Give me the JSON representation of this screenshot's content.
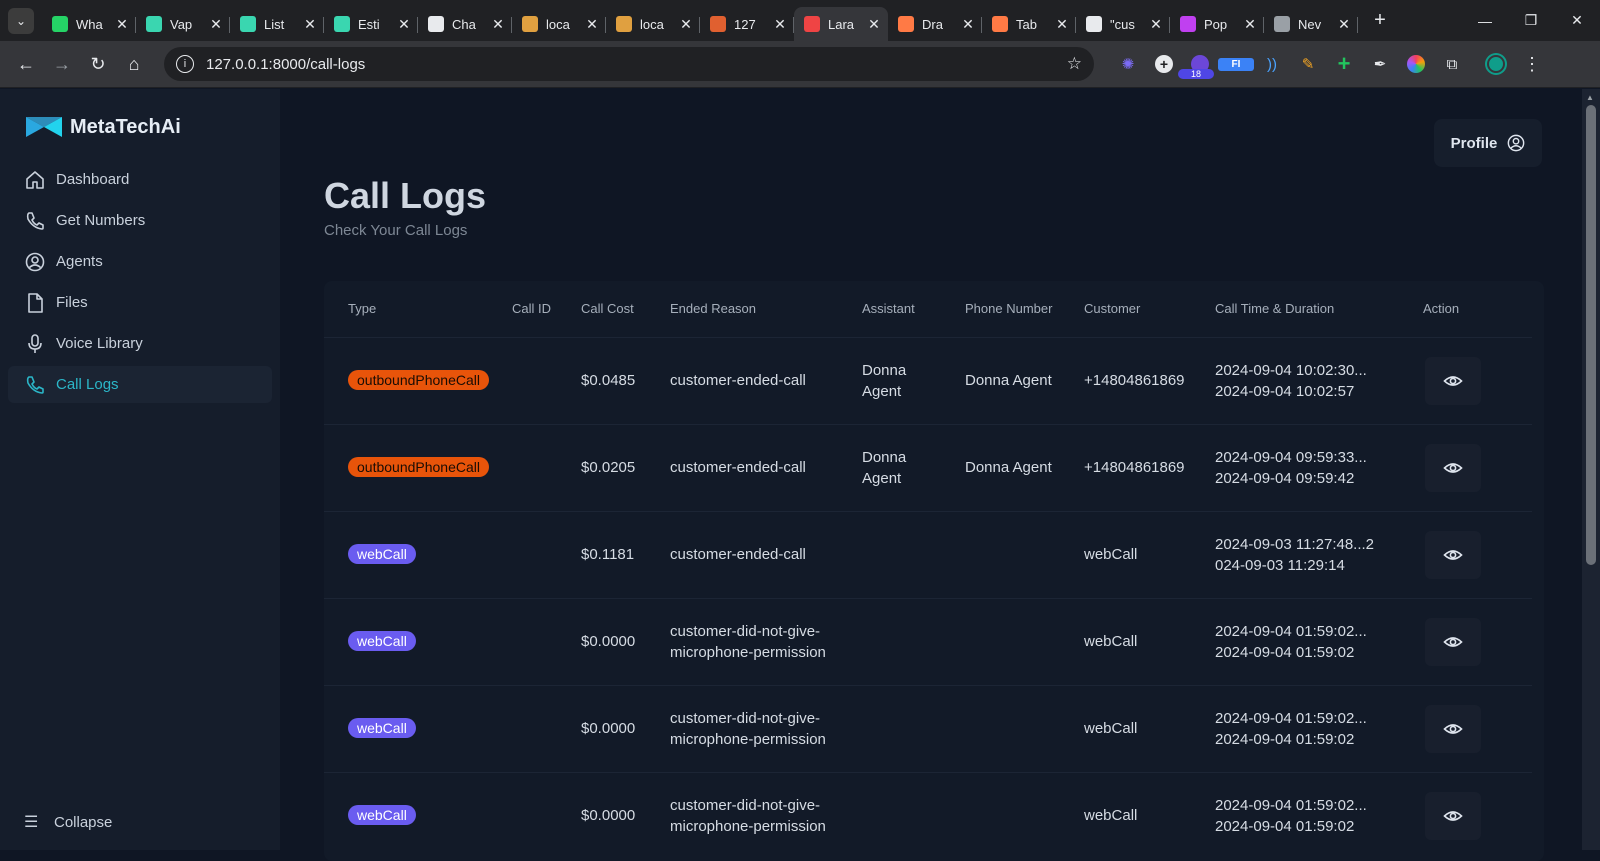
{
  "browser": {
    "tabs": [
      {
        "label": "Wha",
        "icon": "whatsapp-icon",
        "color": "#25d366"
      },
      {
        "label": "Vap",
        "icon": "v-icon",
        "color": "#3ad6b0"
      },
      {
        "label": "List",
        "icon": "v-icon",
        "color": "#3ad6b0"
      },
      {
        "label": "Esti",
        "icon": "v-icon",
        "color": "#3ad6b0"
      },
      {
        "label": "Cha",
        "icon": "chatgpt-icon",
        "color": "#e8eaed"
      },
      {
        "label": "loca",
        "icon": "laravel-icon",
        "color": "#e0a040"
      },
      {
        "label": "loca",
        "icon": "laravel-icon",
        "color": "#e0a040"
      },
      {
        "label": "127",
        "icon": "grid-icon",
        "color": "#e06030"
      },
      {
        "label": "Lara",
        "icon": "laravel-red-icon",
        "color": "#ef4444",
        "active": true
      },
      {
        "label": "Dra",
        "icon": "m-icon",
        "color": "#ff7a45"
      },
      {
        "label": "Tab",
        "icon": "m-icon",
        "color": "#ff7a45"
      },
      {
        "label": "\"cus",
        "icon": "github-icon",
        "color": "#e8eaed"
      },
      {
        "label": "Pop",
        "icon": "circle-icon",
        "color": "#c040f0"
      },
      {
        "label": "Nev",
        "icon": "chrome-icon",
        "color": "#9aa0a6"
      }
    ],
    "url": "127.0.0.1:8000/call-logs",
    "ext_badge": "18"
  },
  "sidebar": {
    "brand": "MetaTechAi",
    "items": [
      {
        "label": "Dashboard",
        "icon": "home-icon"
      },
      {
        "label": "Get Numbers",
        "icon": "phone-icon"
      },
      {
        "label": "Agents",
        "icon": "user-circle-icon"
      },
      {
        "label": "Files",
        "icon": "file-icon"
      },
      {
        "label": "Voice Library",
        "icon": "microphone-icon"
      },
      {
        "label": "Call Logs",
        "icon": "phone-icon",
        "active": true
      }
    ],
    "collapse_label": "Collapse"
  },
  "header": {
    "profile_label": "Profile",
    "title": "Call Logs",
    "subtitle": "Check Your Call Logs"
  },
  "table": {
    "columns": [
      "Type",
      "Call ID",
      "Call Cost",
      "Ended Reason",
      "Assistant",
      "Phone Number",
      "Customer",
      "Call Time & Duration",
      "Action"
    ],
    "rows": [
      {
        "type": "outboundPhoneCall",
        "call_id": "",
        "cost": "$0.0485",
        "reason": "customer-ended-call",
        "assistant": "Donna Agent",
        "phone": "Donna Agent",
        "customer": "+14804861869",
        "time": "2024-09-04 10:02:30...2024-09-04 10:02:57"
      },
      {
        "type": "outboundPhoneCall",
        "call_id": "",
        "cost": "$0.0205",
        "reason": "customer-ended-call",
        "assistant": "Donna Agent",
        "phone": "Donna Agent",
        "customer": "+14804861869",
        "time": "2024-09-04 09:59:33...2024-09-04 09:59:42"
      },
      {
        "type": "webCall",
        "call_id": "",
        "cost": "$0.1181",
        "reason": "customer-ended-call",
        "assistant": "",
        "phone": "",
        "customer": "webCall",
        "time": "2024-09-03 11:27:48...2024-09-03 11:29:14"
      },
      {
        "type": "webCall",
        "call_id": "",
        "cost": "$0.0000",
        "reason": "customer-did-not-give-microphone-permission",
        "assistant": "",
        "phone": "",
        "customer": "webCall",
        "time": "2024-09-04 01:59:02...2024-09-04 01:59:02"
      },
      {
        "type": "webCall",
        "call_id": "",
        "cost": "$0.0000",
        "reason": "customer-did-not-give-microphone-permission",
        "assistant": "",
        "phone": "",
        "customer": "webCall",
        "time": "2024-09-04 01:59:02...2024-09-04 01:59:02"
      },
      {
        "type": "webCall",
        "call_id": "",
        "cost": "$0.0000",
        "reason": "customer-did-not-give-microphone-permission",
        "assistant": "",
        "phone": "",
        "customer": "webCall",
        "time": "2024-09-04 01:59:02...2024-09-04 01:59:02"
      }
    ]
  },
  "colors": {
    "accent": "#2bb6c8",
    "outbound_badge": "#e8540a",
    "web_badge": "#6a5cf0"
  }
}
